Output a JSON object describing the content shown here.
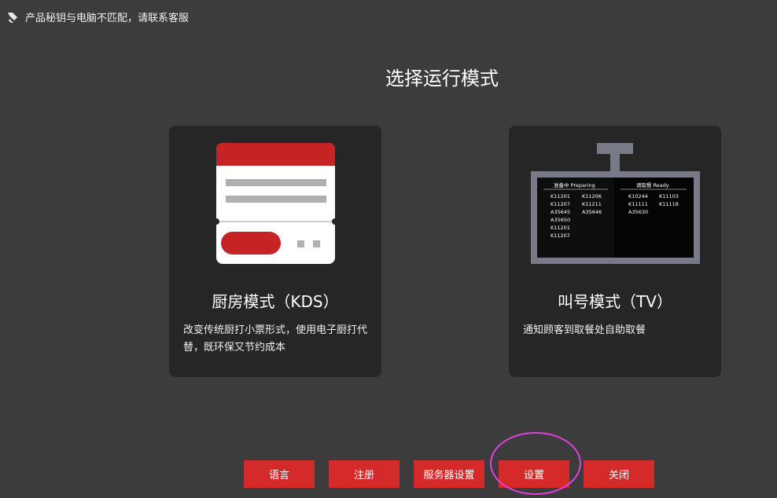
{
  "header": {
    "warning_text": "产品秘钥与电脑不匹配，请联系客服",
    "icon": "wrench-icon"
  },
  "page_title": "选择运行模式",
  "cards": {
    "kds": {
      "title": "厨房模式（KDS）",
      "description": "改变传统厨打小票形式，使用电子厨打代替，既环保又节约成本"
    },
    "tv": {
      "title": "叫号模式（TV）",
      "description": "通知顾客到取餐处自助取餐",
      "screen": {
        "preparing_label": "准备中 Preparing",
        "ready_label": "请取餐 Ready",
        "preparing_col1": [
          "K11201",
          "K11207",
          "A35645",
          "A35650",
          "K11201",
          "K11207"
        ],
        "preparing_col2": [
          "K11206",
          "K11211",
          "A35646"
        ],
        "ready_col1": [
          "K10244",
          "K11111",
          "A35630"
        ],
        "ready_col2": [
          "K11103",
          "K11118"
        ]
      }
    }
  },
  "buttons": {
    "language": "语言",
    "register": "注册",
    "server_settings": "服务器设置",
    "settings": "设置",
    "close": "关闭"
  },
  "colors": {
    "background": "#3c3c3c",
    "card": "#262626",
    "accent_red": "#d42a2a",
    "highlight": "#e040e0"
  }
}
